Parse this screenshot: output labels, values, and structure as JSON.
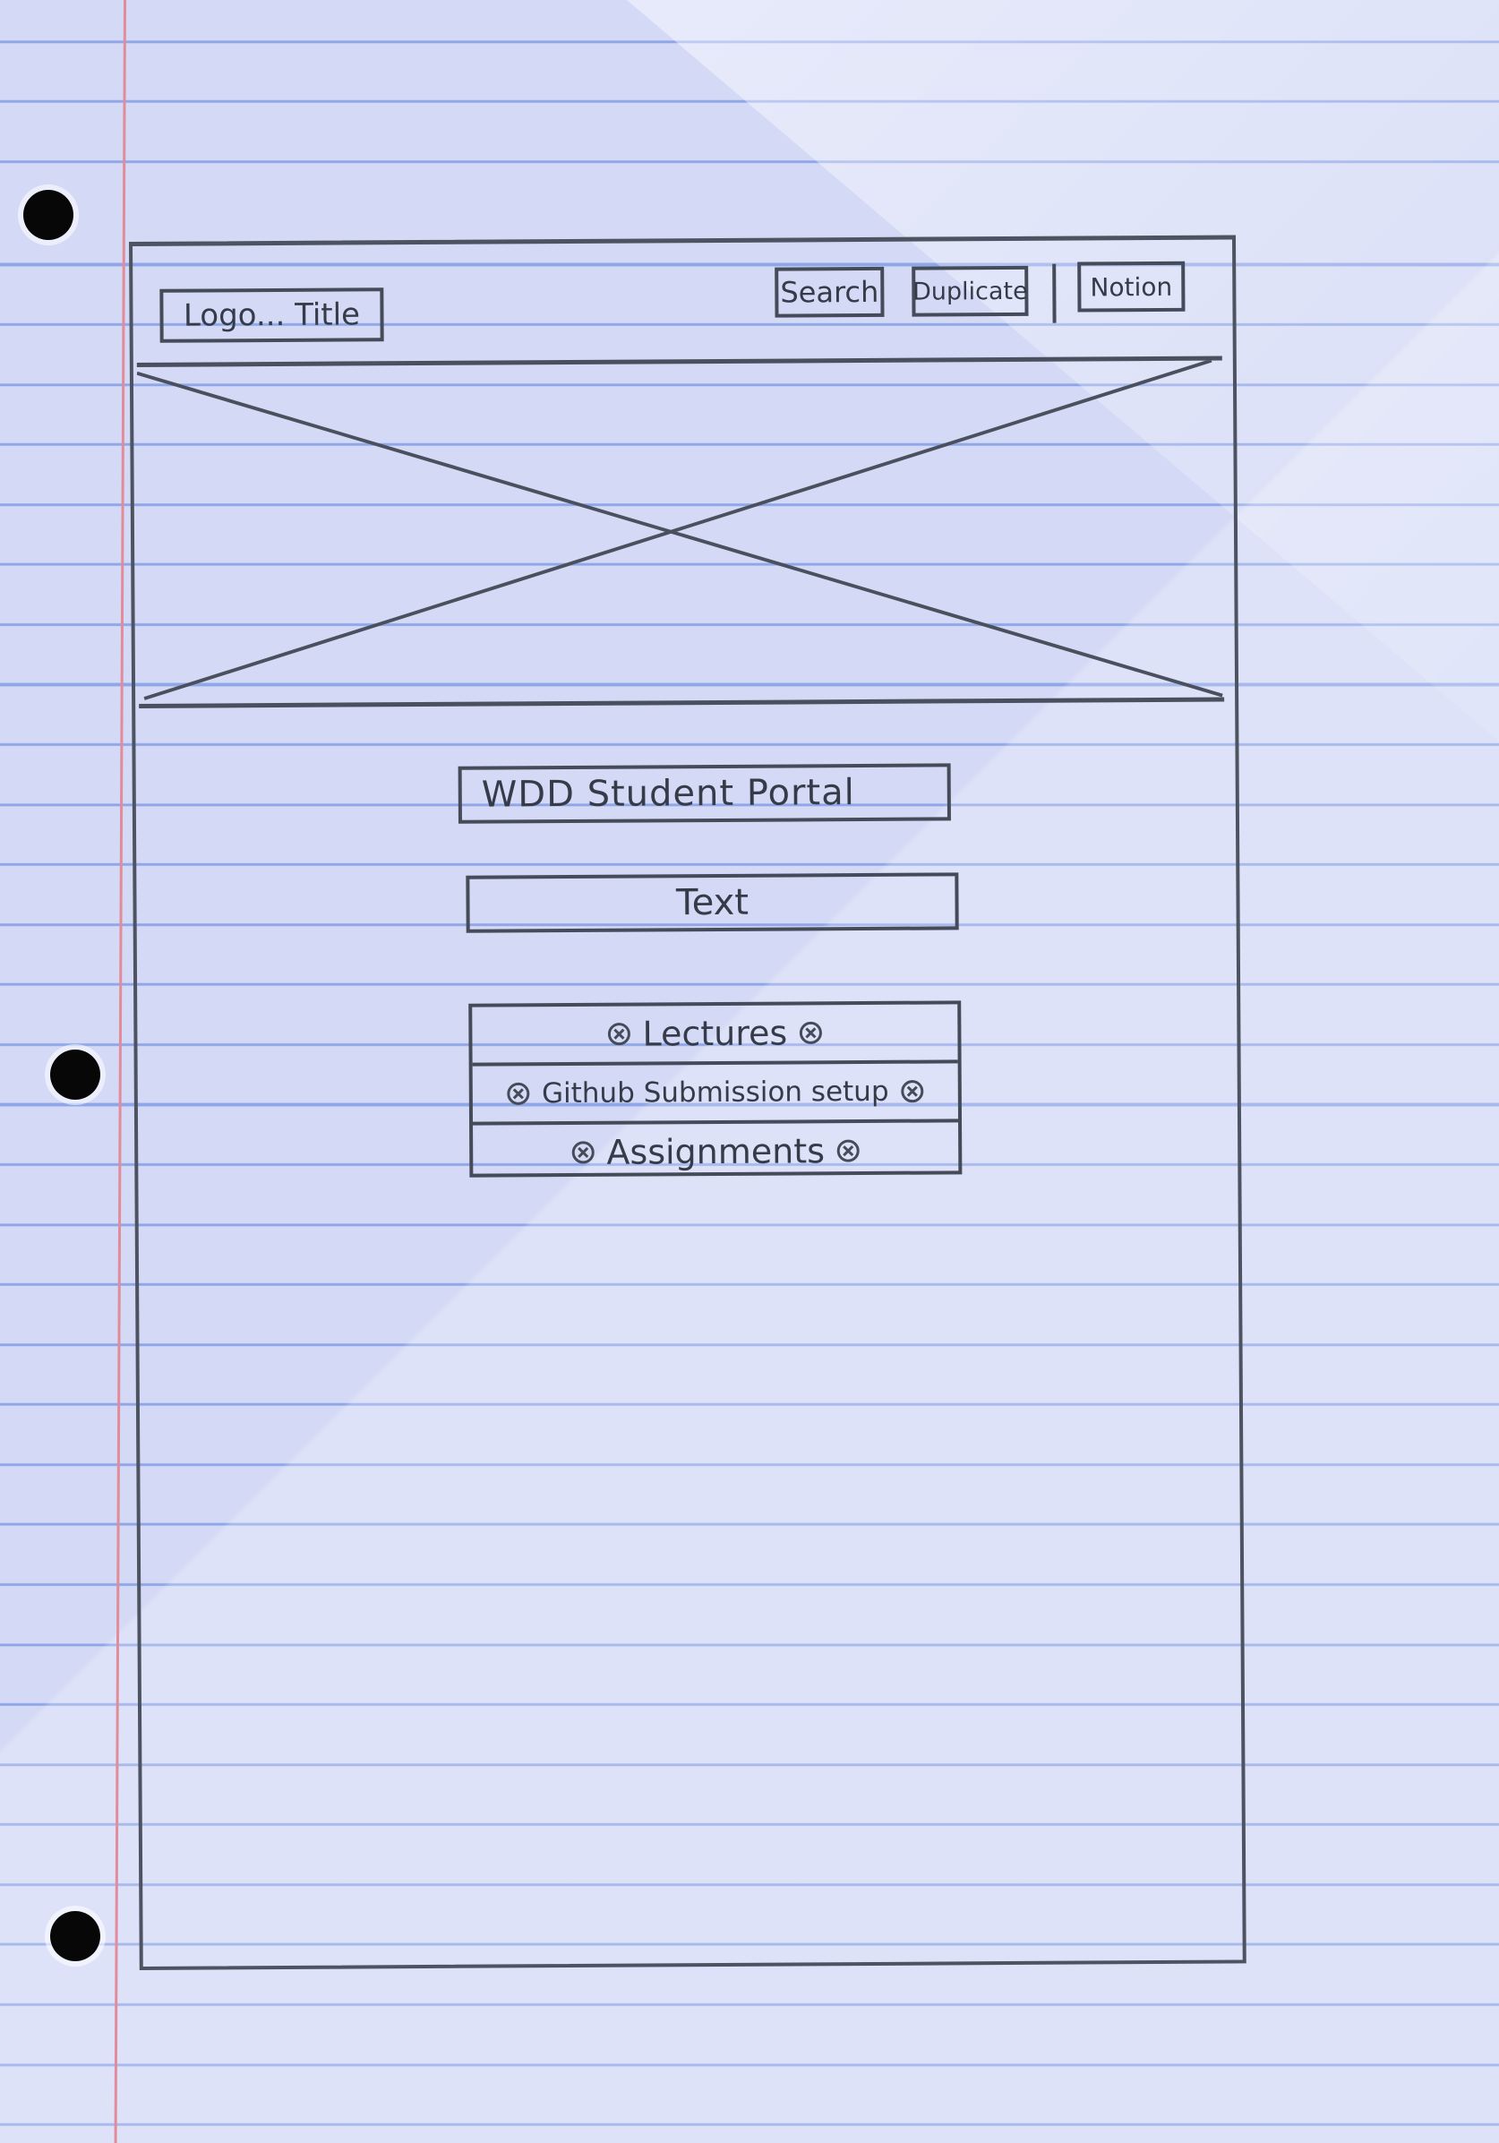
{
  "header": {
    "logo_title": "Logo... Title",
    "buttons": {
      "search": "Search",
      "duplicate": "Duplicate",
      "notion": "Notion"
    }
  },
  "main": {
    "title": "WDD Student Portal",
    "text": "Text",
    "nav_items": [
      {
        "label": "Lectures",
        "icon": "x-circle-icon"
      },
      {
        "label": "Github Submission setup",
        "icon": "x-circle-icon"
      },
      {
        "label": "Assignments",
        "icon": "x-circle-icon"
      }
    ]
  },
  "colors": {
    "paper": "#d4daf6",
    "rule_line": "#8fa6e8",
    "margin_line": "#e28b9a",
    "pencil": "#454b58"
  }
}
